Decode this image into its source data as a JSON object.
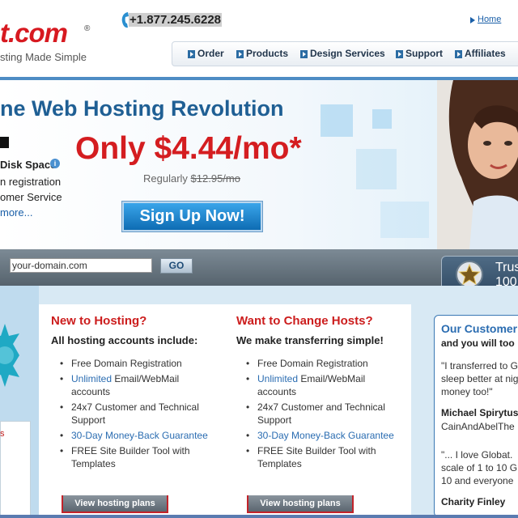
{
  "header": {
    "logo_text": "t.com",
    "logo_reg": "®",
    "tagline": "sting Made Simple",
    "phone": "+1.877.245.6228",
    "home_link": "Home"
  },
  "nav": {
    "items": [
      "Order",
      "Products",
      "Design Services",
      "Support",
      "Affiliates"
    ]
  },
  "hero": {
    "title": "ne Web Hosting Revolution",
    "price": "Only $4.44/mo*",
    "regularly_label": "Regularly",
    "regular_price": "$12.95/mo",
    "features": [
      "Disk Space",
      "n registration",
      "omer Service"
    ],
    "info_icon": "i",
    "more_link": "more...",
    "signup_label": "Sign Up Now!"
  },
  "domain_search": {
    "input_value": "your-domain.com",
    "go_label": "GO",
    "trust_line1": "Trus",
    "trust_line2": "100"
  },
  "left_edge": {
    "red_text": "s"
  },
  "col_new": {
    "title": "New to Hosting?",
    "subtitle": "All hosting accounts include:",
    "items": [
      {
        "pre": "",
        "blue": "",
        "post": "Free Domain Registration"
      },
      {
        "pre": "",
        "blue": "Unlimited",
        "post": " Email/WebMail accounts"
      },
      {
        "pre": "",
        "blue": "",
        "post": "24x7 Customer and Technical Support"
      },
      {
        "pre": "",
        "blue": "30-Day Money-Back Guarantee",
        "post": ""
      },
      {
        "pre": "",
        "blue": "",
        "post": "FREE Site Builder Tool with Templates"
      }
    ],
    "button_label": "View hosting plans"
  },
  "col_change": {
    "title": "Want to Change Hosts?",
    "subtitle": "We make transferring simple!",
    "items": [
      {
        "pre": "",
        "blue": "",
        "post": "Free Domain Registration"
      },
      {
        "pre": "",
        "blue": "Unlimited",
        "post": " Email/WebMail accounts"
      },
      {
        "pre": "",
        "blue": "",
        "post": "24x7 Customer and Technical Support"
      },
      {
        "pre": "",
        "blue": "30-Day Money-Back Guarantee",
        "post": ""
      },
      {
        "pre": "",
        "blue": "",
        "post": "FREE Site Builder Tool with Templates"
      }
    ],
    "button_label": "View hosting plans"
  },
  "customers": {
    "title": "Our Customer",
    "subtitle": "and you will too",
    "quote1": [
      "\"I transferred to G",
      "sleep better at nig",
      "money too!\""
    ],
    "name1": "Michael Spirytus",
    "site1": "CainAndAbelThe",
    "quote2": [
      "\"... I love Globat.",
      "scale of 1 to 10 G",
      "10 and everyone"
    ],
    "name2": "Charity Finley"
  },
  "colors": {
    "brand_red": "#d41d20",
    "brand_blue": "#1f5f94",
    "nav_blue": "#2b6ca3"
  }
}
